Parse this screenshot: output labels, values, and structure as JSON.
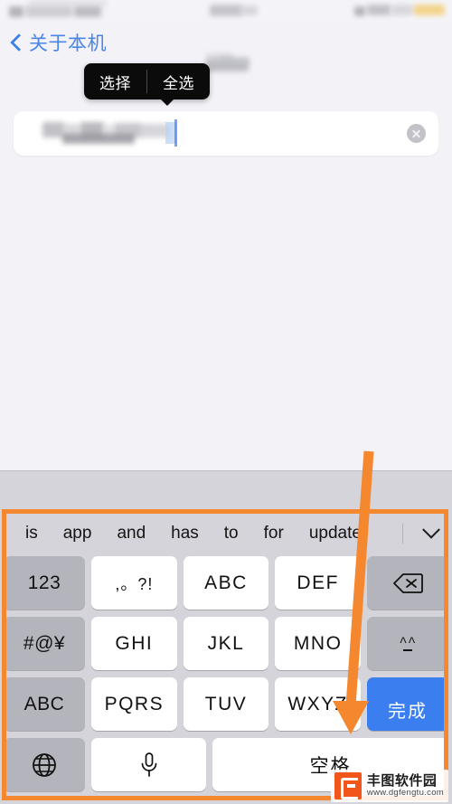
{
  "status_bar": {
    "redacted": true,
    "accent_color": "#f2c14b"
  },
  "nav": {
    "back_label": "关于本机",
    "back_icon": "chevron-left-icon",
    "accent_color": "#4a85e8"
  },
  "context_menu": {
    "items": [
      {
        "label": "选择"
      },
      {
        "label": "全选"
      }
    ],
    "background": "#0b0b0b"
  },
  "text_field": {
    "value": "",
    "placeholder": "",
    "redacted": true,
    "clear_icon": "clear-circle-icon"
  },
  "keyboard": {
    "predictions": [
      "is",
      "app",
      "and",
      "has",
      "to",
      "for",
      "update"
    ],
    "collapse_icon": "chevron-down-icon",
    "rows": [
      [
        {
          "label": "123",
          "type": "fn",
          "name": "key-123"
        },
        {
          "label": ",。?!",
          "type": "punct",
          "name": "key-punctuation"
        },
        {
          "label": "ABC",
          "type": "letter",
          "name": "key-abc-2"
        },
        {
          "label": "DEF",
          "type": "letter",
          "name": "key-def"
        },
        {
          "label": "",
          "type": "icon",
          "icon": "backspace-icon",
          "name": "key-backspace"
        }
      ],
      [
        {
          "label": "#@¥",
          "type": "fn",
          "name": "key-symbols"
        },
        {
          "label": "GHI",
          "type": "letter",
          "name": "key-ghi"
        },
        {
          "label": "JKL",
          "type": "letter",
          "name": "key-jkl"
        },
        {
          "label": "MNO",
          "type": "letter",
          "name": "key-mno"
        },
        {
          "label": "^^",
          "type": "fn",
          "name": "key-kaomoji"
        }
      ],
      [
        {
          "label": "ABC",
          "type": "fn",
          "name": "key-abc-mode"
        },
        {
          "label": "PQRS",
          "type": "letter",
          "name": "key-pqrs"
        },
        {
          "label": "TUV",
          "type": "letter",
          "name": "key-tuv"
        },
        {
          "label": "WXYZ",
          "type": "letter",
          "name": "key-wxyz"
        },
        {
          "label": "完成",
          "type": "blue",
          "name": "key-done"
        }
      ],
      [
        {
          "label": "",
          "type": "fn",
          "icon": "globe-icon",
          "name": "key-globe"
        },
        {
          "label": "",
          "type": "letter",
          "icon": "microphone-icon",
          "name": "key-microphone"
        },
        {
          "label": "空格",
          "type": "letter",
          "name": "key-space"
        }
      ]
    ],
    "done_key_color": "#3b7ef0",
    "background": "#d4d4da"
  },
  "annotation": {
    "color": "#f5872e",
    "shapes": [
      "highlight-rectangle",
      "pointer-arrow"
    ],
    "target": "完成"
  },
  "watermark": {
    "title": "丰图软件园",
    "url": "www.dgfengtu.com",
    "logo_color": "#f2561b"
  }
}
